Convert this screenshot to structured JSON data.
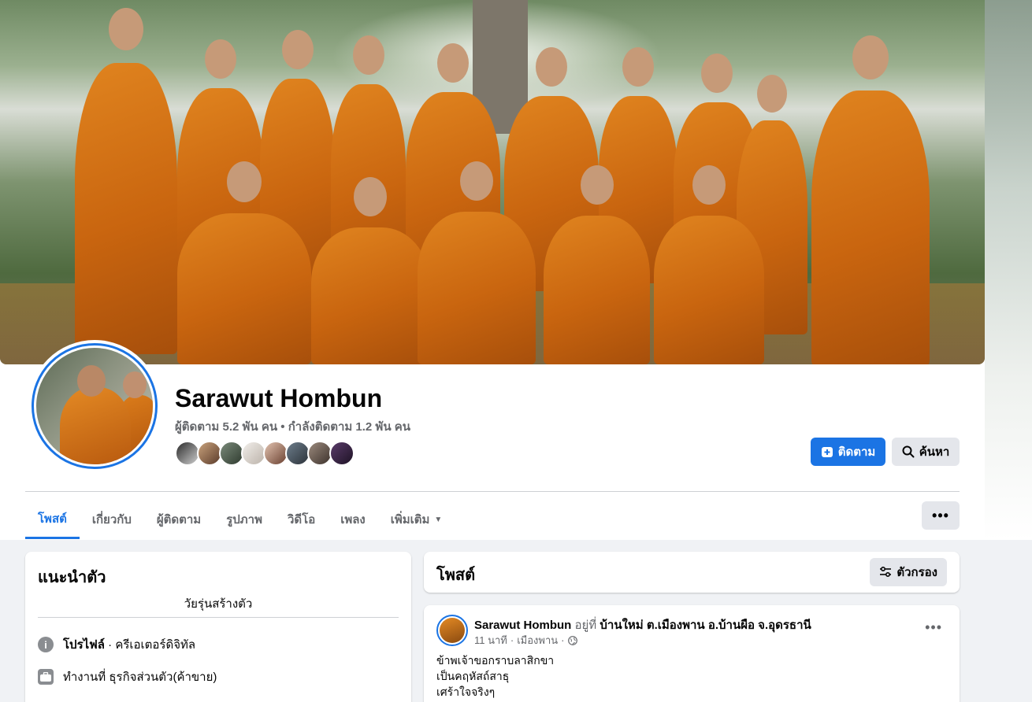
{
  "profile": {
    "name": "Sarawut Hombun",
    "followers_line": "ผู้ติดตาม 5.2 พัน คน • กำลังติดตาม 1.2 พัน คน"
  },
  "actions": {
    "follow_label": "ติดตาม",
    "search_label": "ค้นหา",
    "more_label": "•••"
  },
  "tabs": [
    {
      "label": "โพสต์",
      "active": true
    },
    {
      "label": "เกี่ยวกับ"
    },
    {
      "label": "ผู้ติดตาม"
    },
    {
      "label": "รูปภาพ"
    },
    {
      "label": "วิดีโอ"
    },
    {
      "label": "เพลง"
    },
    {
      "label": "เพิ่มเติม"
    }
  ],
  "intro": {
    "title": "แนะนำตัว",
    "bio": "วัยรุ่นสร้างตัว",
    "profile_label": "โปรไฟล์",
    "profile_value": " · ครีเอเตอร์ดิจิทัล",
    "work_label": "ทำงานที่ ธุรกิจส่วนตัว(ค้าขาย)"
  },
  "posts_section": {
    "title": "โพสต์",
    "filter_label": "ตัวกรอง"
  },
  "post": {
    "author": "Sarawut Hombun",
    "at_word": " อยู่ที่ ",
    "location": "บ้านใหม่ ต.เมืองพาน อ.บ้านผือ จ.อุดรธานี",
    "time": "11 นาที",
    "place": "เมืองพาน",
    "menu": "•••",
    "lines": [
      "ข้าพเจ้าขอกราบลาสิกขา",
      "เป็นคฤหัสถ์สาธุ",
      "เศร้าใจจริงๆ"
    ]
  },
  "colors": {
    "accent": "#1b74e4",
    "page_bg": "#f0f2f5",
    "secondary_text": "#65676b"
  }
}
